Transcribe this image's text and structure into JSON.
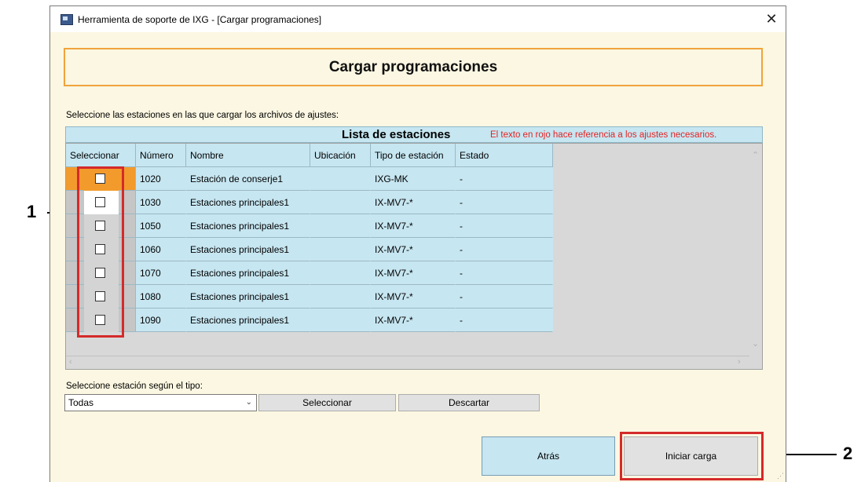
{
  "window": {
    "title": "Herramienta de soporte de IXG - [Cargar programaciones]",
    "close_glyph": "✕"
  },
  "header": {
    "title": "Cargar programaciones"
  },
  "instruction": "Seleccione las estaciones en las que cargar los archivos de ajustes:",
  "list": {
    "title": "Lista de estaciones",
    "hint": "El texto en rojo hace referencia a los ajustes necesarios.",
    "columns": [
      "Seleccionar",
      "Número",
      "Nombre",
      "Ubicación",
      "Tipo de estación",
      "Estado"
    ],
    "rows": [
      {
        "numero": "1020",
        "nombre": "Estación de conserje1",
        "ubicacion": "",
        "tipo": "IXG-MK",
        "estado": "-"
      },
      {
        "numero": "1030",
        "nombre": "Estaciones principales1",
        "ubicacion": "",
        "tipo": "IX-MV7-*",
        "estado": "-"
      },
      {
        "numero": "1050",
        "nombre": "Estaciones principales1",
        "ubicacion": "",
        "tipo": "IX-MV7-*",
        "estado": "-"
      },
      {
        "numero": "1060",
        "nombre": "Estaciones principales1",
        "ubicacion": "",
        "tipo": "IX-MV7-*",
        "estado": "-"
      },
      {
        "numero": "1070",
        "nombre": "Estaciones principales1",
        "ubicacion": "",
        "tipo": "IX-MV7-*",
        "estado": "-"
      },
      {
        "numero": "1080",
        "nombre": "Estaciones principales1",
        "ubicacion": "",
        "tipo": "IX-MV7-*",
        "estado": "-"
      },
      {
        "numero": "1090",
        "nombre": "Estaciones principales1",
        "ubicacion": "",
        "tipo": "IX-MV7-*",
        "estado": "-"
      }
    ]
  },
  "filter": {
    "label": "Seleccione estación según el tipo:",
    "selected": "Todas",
    "select_button": "Seleccionar",
    "clear_button": "Descartar"
  },
  "actions": {
    "back": "Atrás",
    "start": "Iniciar carga"
  },
  "callouts": {
    "one": "1",
    "two": "2"
  },
  "colors": {
    "accent_orange": "#f39a2c",
    "highlight_red": "#d42a2a",
    "list_blue": "#c6e6f1",
    "window_bg": "#fbf7e2"
  }
}
